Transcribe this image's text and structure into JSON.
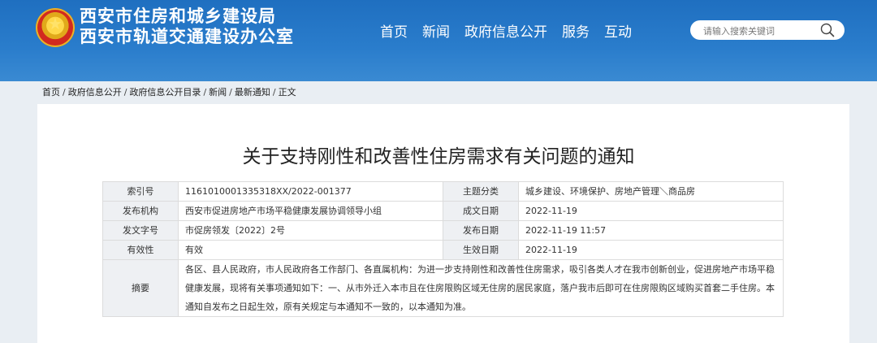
{
  "header": {
    "org_line1": "西安市住房和城乡建设局",
    "org_line2": "西安市轨道交通建设办公室",
    "emblem_icon": "national-emblem-icon",
    "brand_color": "#1f6fc0"
  },
  "nav": {
    "items": [
      "首页",
      "新闻",
      "政府信息公开",
      "服务",
      "互动"
    ]
  },
  "search": {
    "placeholder": "请输入搜索关键词",
    "icon": "search-icon"
  },
  "breadcrumb": {
    "items": [
      "首页",
      "政府信息公开",
      "政府信息公开目录",
      "新闻",
      "最新通知",
      "正文"
    ],
    "separator": "/"
  },
  "document": {
    "title": "关于支持刚性和改善性住房需求有关问题的通知",
    "meta": {
      "index_label": "索引号",
      "index_value": "1161010001335318XX/2022-001377",
      "topic_label": "主题分类",
      "topic_value": "城乡建设、环境保护、房地产管理＼商品房",
      "issuer_label": "发布机构",
      "issuer_value": "西安市促进房地产市场平稳健康发展协调领导小组",
      "created_label": "成文日期",
      "created_value": "2022-11-19",
      "docno_label": "发文字号",
      "docno_value": "市促房领发〔2022〕2号",
      "published_label": "发布日期",
      "published_value": "2022-11-19 11:57",
      "validity_label": "有效性",
      "validity_value": "有效",
      "effective_label": "生效日期",
      "effective_value": "2022-11-19",
      "abstract_label": "摘要",
      "abstract_value": "各区、县人民政府，市人民政府各工作部门、各直属机构：为进一步支持刚性和改善性住房需求，吸引各类人才在我市创新创业，促进房地产市场平稳健康发展，现将有关事项通知如下：一、从市外迁入本市且在住房限购区域无住房的居民家庭，落户我市后即可在住房限购区域购买首套二手住房。本通知自发布之日起生效，原有关规定与本通知不一致的，以本通知为准。"
    }
  }
}
